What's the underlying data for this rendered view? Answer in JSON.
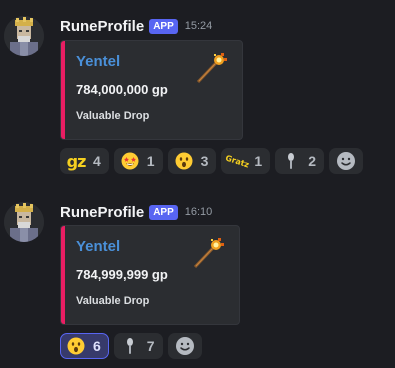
{
  "colors": {
    "background": "#1c1d22",
    "embed_bar": "#e91e63",
    "embed_title": "#4a90d9",
    "app_badge": "#5865f2",
    "reaction_active": "#5865f2"
  },
  "messages": [
    {
      "username": "RuneProfile",
      "badge": "APP",
      "timestamp": "15:24",
      "embed": {
        "title": "Yentel",
        "value": "784,000,000 gp",
        "footer": "Valuable Drop",
        "thumbnail_icon": "staff-icon"
      },
      "reactions": [
        {
          "emoji": "gz-text-emoji",
          "count": "4",
          "active": false
        },
        {
          "emoji": "star-struck-emoji",
          "count": "1",
          "active": false
        },
        {
          "emoji": "astonished-face-emoji",
          "count": "3",
          "active": false
        },
        {
          "emoji": "gratz-text-emoji",
          "count": "1",
          "active": false
        },
        {
          "emoji": "spoon-emoji",
          "count": "2",
          "active": false
        }
      ]
    },
    {
      "username": "RuneProfile",
      "badge": "APP",
      "timestamp": "16:10",
      "embed": {
        "title": "Yentel",
        "value": "784,999,999 gp",
        "footer": "Valuable Drop",
        "thumbnail_icon": "staff-icon"
      },
      "reactions": [
        {
          "emoji": "astonished-face-emoji",
          "count": "6",
          "active": true
        },
        {
          "emoji": "spoon-emoji",
          "count": "7",
          "active": false
        }
      ]
    }
  ],
  "emoji_text": {
    "gz": "gz",
    "gratz": "Gratz"
  }
}
